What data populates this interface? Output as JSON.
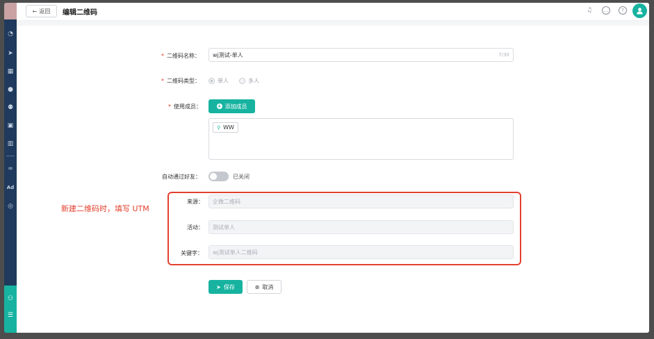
{
  "header": {
    "back_label": "返回",
    "title": "编辑二维码",
    "icons": [
      "bell-icon",
      "message-icon",
      "help-icon",
      "user-avatar"
    ]
  },
  "sidebar": {
    "icons": [
      "dashboard-icon",
      "send-icon",
      "calendar-icon",
      "user-icon",
      "users-icon",
      "bookmark-icon",
      "chart-icon",
      "link-icon",
      "ad-icon",
      "settings-icon",
      "team-icon",
      "list-icon"
    ],
    "ad_text": "Ad"
  },
  "form": {
    "name": {
      "label": "二维码名称：",
      "value": "wj测试-单人",
      "counter": "7/30"
    },
    "type": {
      "label": "二维码类型：",
      "options": [
        "单人",
        "多人"
      ],
      "selected": "单人"
    },
    "members": {
      "label": "使用成员：",
      "add_button": "添加成员",
      "items": [
        "WW"
      ]
    },
    "auto_friend": {
      "label": "自动通过好友：",
      "state_text": "已关闭"
    },
    "utm": {
      "source": {
        "label": "来源：",
        "placeholder": "企微二维码"
      },
      "campaign": {
        "label": "活动：",
        "placeholder": "测试单人"
      },
      "keyword": {
        "label": "关键字：",
        "placeholder": "wj测试单人二维码"
      }
    },
    "save_label": "保存",
    "cancel_label": "取消"
  },
  "annotation": "新建二维码时，填写 UTM",
  "colors": {
    "accent": "#17b3a0",
    "sidebar": "#1f3a5c",
    "annotation": "#e3402f"
  }
}
